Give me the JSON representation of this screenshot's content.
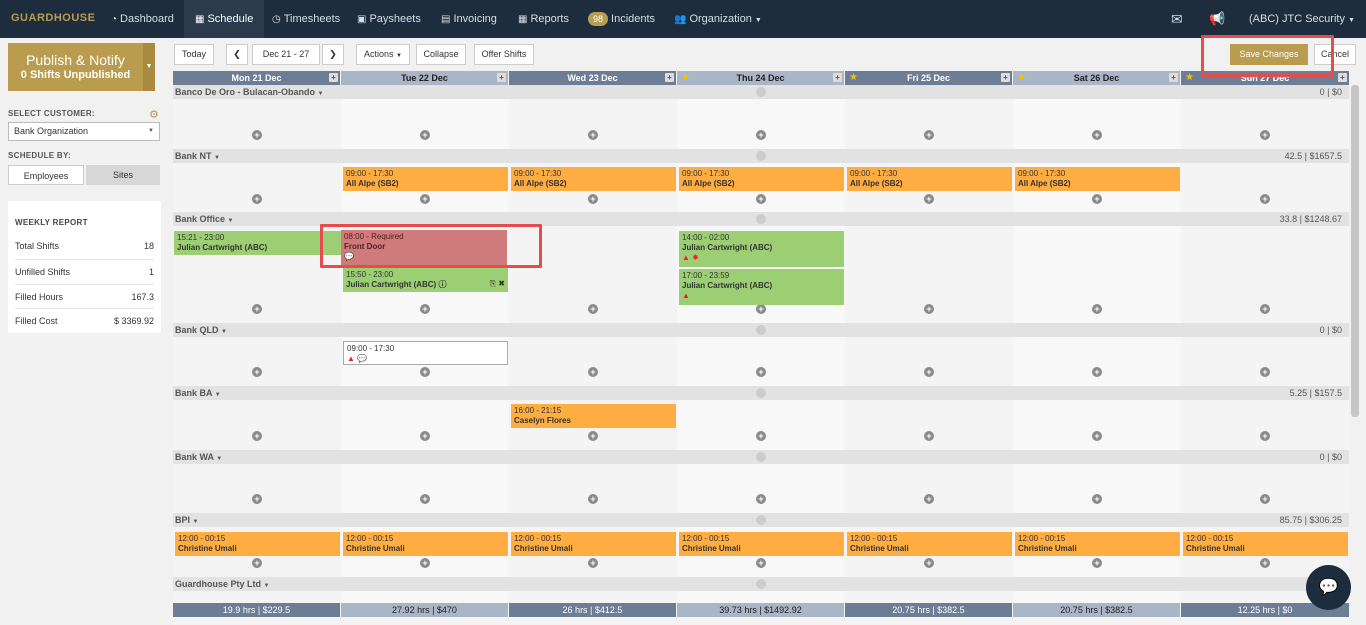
{
  "nav": {
    "logo": "GUARDHOUSE",
    "items": [
      {
        "label": "Dashboard"
      },
      {
        "label": "Schedule"
      },
      {
        "label": "Timesheets"
      },
      {
        "label": "Paysheets"
      },
      {
        "label": "Invoicing"
      },
      {
        "label": "Reports"
      },
      {
        "label": "Incidents",
        "badge": "98"
      },
      {
        "label": "Organization"
      }
    ],
    "account": "(ABC) JTC Security"
  },
  "sidebar": {
    "publish_title": "Publish & Notify",
    "publish_sub": "0 Shifts Unpublished",
    "select_customer_label": "SELECT CUSTOMER:",
    "customer_value": "Bank Organization",
    "schedule_by_label": "SCHEDULE BY:",
    "schedule_by_options": [
      "Employees",
      "Sites"
    ],
    "weekly_report": {
      "title": "WEEKLY REPORT",
      "rows": [
        {
          "label": "Total Shifts",
          "value": "18"
        },
        {
          "label": "Unfilled Shifts",
          "value": "1"
        },
        {
          "label": "Filled Hours",
          "value": "167.3"
        },
        {
          "label": "Filled Cost",
          "value": "$ 3369.92"
        }
      ]
    }
  },
  "toolbar": {
    "today": "Today",
    "date_range": "Dec 21 - 27",
    "actions": "Actions",
    "collapse": "Collapse",
    "offer_shifts": "Offer Shifts",
    "save_changes": "Save Changes",
    "cancel": "Cancel"
  },
  "days": [
    {
      "label": "Mon 21 Dec",
      "star": false
    },
    {
      "label": "Tue 22 Dec",
      "star": false
    },
    {
      "label": "Wed 23 Dec",
      "star": false
    },
    {
      "label": "Thu 24 Dec",
      "star": true
    },
    {
      "label": "Fri 25 Dec",
      "star": true
    },
    {
      "label": "Sat 26 Dec",
      "star": true
    },
    {
      "label": "Sun 27 Dec",
      "star": true
    }
  ],
  "groups": [
    {
      "name": "Banco De Oro - Bulacan-Obando",
      "total": "0 | $0"
    },
    {
      "name": "Bank NT",
      "total": "42.5 | $1657.5"
    },
    {
      "name": "Bank Office",
      "total": "33.8 | $1248.67"
    },
    {
      "name": "Bank QLD",
      "total": "0 | $0"
    },
    {
      "name": "Bank BA",
      "total": "5.25 | $157.5"
    },
    {
      "name": "Bank WA",
      "total": "0 | $0"
    },
    {
      "name": "BPI",
      "total": "85.75 | $306.25"
    },
    {
      "name": "Guardhouse Pty Ltd",
      "total": ""
    }
  ],
  "shifts": {
    "ballpe_time": "09:00 - 17:30",
    "ballpe_name": "All Alpe (SB2)",
    "jc1_time": "15:21 - 23:00",
    "jc_name": "Julian Cartwright (ABC)",
    "req_time": "08:00 - Required",
    "req_site": "Front Door",
    "jc2_time": "15:50 - 23:00",
    "thu1_time": "14:00 - 02:00",
    "thu2_time": "17:00 - 23:59",
    "qld_time": "09:00 - 17:30",
    "ba_time": "16:00 - 21:15",
    "ba_name": "Caselyn Flores",
    "bpi_time": "12:00 - 00:15",
    "bpi_name": "Christine Umali"
  },
  "totals": [
    "19.9 hrs   | $229.5",
    "27.92 hrs   | $470",
    "26 hrs   | $412.5",
    "39.73 hrs   | $1492.92",
    "20.75 hrs   | $382.5",
    "20.75 hrs   | $382.5",
    "12.25 hrs   | $0"
  ]
}
